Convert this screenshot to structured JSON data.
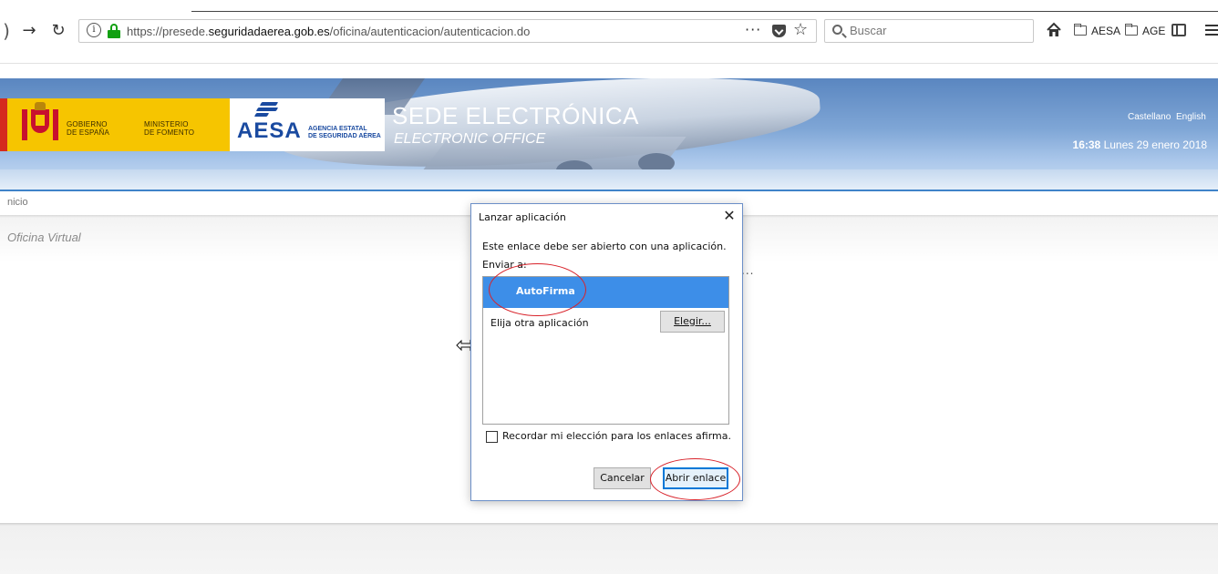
{
  "browser": {
    "url_prefix": "https://presede.",
    "url_domain": "seguridadaerea.gob.es",
    "url_path": "/oficina/autenticacion/autenticacion.do",
    "search_placeholder": "Buscar",
    "bookmarks": [
      {
        "label": "AESA"
      },
      {
        "label": "AGE"
      }
    ],
    "icons": [
      "back-arrow-icon",
      "forward-arrow-icon",
      "reload-icon",
      "info-icon",
      "lock-icon",
      "page-actions-icon",
      "pocket-icon",
      "bookmark-star-icon",
      "search-icon",
      "home-icon",
      "folder-icon",
      "sidebar-icon",
      "menu-icon"
    ]
  },
  "site": {
    "gobierno_line1": "GOBIERNO",
    "gobierno_line2": "DE ESPAÑA",
    "ministerio_line1": "MINISTERIO",
    "ministerio_line2": "DE FOMENTO",
    "aesa_logo": "AESA",
    "aesa_sub_line1": "AGENCIA ESTATAL",
    "aesa_sub_line2": "DE SEGURIDAD AÉREA",
    "title": "SEDE ELECTRÓNICA",
    "subtitle": "ELECTRONIC OFFICE",
    "lang_es": "Castellano",
    "lang_en": "English",
    "time": "16:38",
    "date": "Lunes 29 enero 2018",
    "breadcrumb": "nicio",
    "section_title": "Oficina Virtual",
    "ellipsis": "...",
    "colors": {
      "header_blue": "#6f98cc",
      "gobierno_yellow": "#f6c500",
      "aesa_blue": "#1a4aa0",
      "highlight_red": "#d8222a"
    }
  },
  "dialog": {
    "title": "Lanzar aplicación",
    "close": "✕",
    "message": "Este enlace debe ser abierto con una aplicación.",
    "send_to": "Enviar a:",
    "selected_app": "AutoFirma",
    "other_app": "Elija otra aplicación",
    "choose_button": "Elegir...",
    "remember": "Recordar mi elección para los enlaces afirma.",
    "cancel_button": "Cancelar",
    "open_button": "Abrir enlace",
    "accent": "#3d8ee8"
  }
}
